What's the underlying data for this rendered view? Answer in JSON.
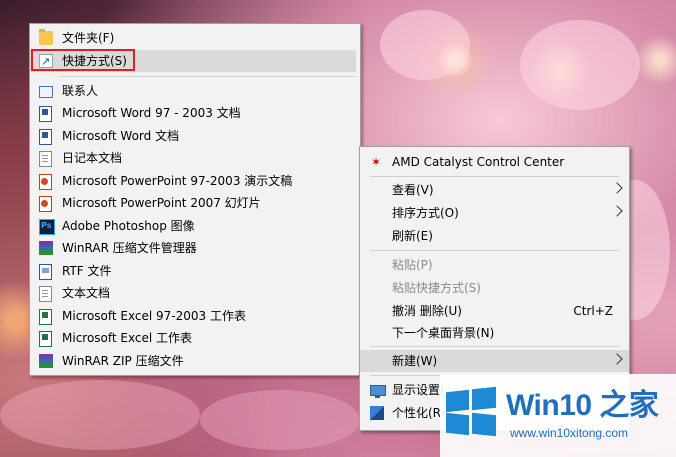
{
  "new_submenu": {
    "items": [
      {
        "label": "文件夹(F)",
        "icon": "folder-icon"
      },
      {
        "label": "快捷方式(S)",
        "icon": "shortcut-icon"
      },
      {
        "label": "联系人",
        "icon": "contact-icon"
      },
      {
        "label": "Microsoft Word 97 - 2003 文档",
        "icon": "word-icon"
      },
      {
        "label": "Microsoft Word 文档",
        "icon": "word-icon"
      },
      {
        "label": "日记本文档",
        "icon": "journal-document-icon"
      },
      {
        "label": "Microsoft PowerPoint 97-2003 演示文稿",
        "icon": "powerpoint-icon"
      },
      {
        "label": "Microsoft PowerPoint 2007 幻灯片",
        "icon": "powerpoint-icon"
      },
      {
        "label": "Adobe Photoshop 图像",
        "icon": "photoshop-icon"
      },
      {
        "label": "WinRAR 压缩文件管理器",
        "icon": "winrar-icon"
      },
      {
        "label": "RTF 文件",
        "icon": "rtf-icon"
      },
      {
        "label": "文本文档",
        "icon": "text-document-icon"
      },
      {
        "label": "Microsoft Excel 97-2003 工作表",
        "icon": "excel-icon"
      },
      {
        "label": "Microsoft Excel 工作表",
        "icon": "excel-icon"
      },
      {
        "label": "WinRAR ZIP 压缩文件",
        "icon": "winrar-zip-icon"
      }
    ]
  },
  "context_menu": {
    "amd": {
      "label": "AMD Catalyst Control Center",
      "icon": "amd-icon"
    },
    "view": {
      "label": "查看(V)"
    },
    "sort": {
      "label": "排序方式(O)"
    },
    "refresh": {
      "label": "刷新(E)"
    },
    "paste": {
      "label": "粘贴(P)"
    },
    "paste_shortcut": {
      "label": "粘贴快捷方式(S)"
    },
    "undo_delete": {
      "label": "撤消 删除(U)",
      "shortcut": "Ctrl+Z"
    },
    "next_background": {
      "label": "下一个桌面背景(N)"
    },
    "new": {
      "label": "新建(W)"
    },
    "display_settings": {
      "label": "显示设置(",
      "icon": "display-settings-icon"
    },
    "personalize": {
      "label": "个性化(R)",
      "icon": "personalize-icon"
    }
  },
  "watermark": {
    "title": "Win10 之家",
    "url": "www.win10xitong.com",
    "brand_color": "#1f6fbd"
  },
  "colors": {
    "menu_background": "#f2f2f2",
    "highlight_row": "#dadada",
    "callout_border": "#e02020"
  }
}
